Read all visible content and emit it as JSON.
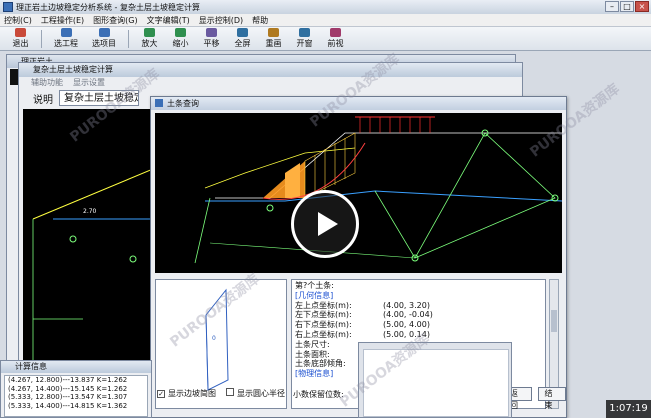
{
  "app": {
    "title": "理正岩土边坡稳定分析系统 - 复杂土层土坡稳定计算",
    "menu": [
      "控制(C)",
      "工程操作(E)",
      "图形查询(G)",
      "文字编辑(T)",
      "显示控制(D)",
      "帮助"
    ],
    "toolbar": [
      {
        "label": "退出",
        "color": "#c94a3a"
      },
      {
        "label": "选工程",
        "color": "#3b6fb6"
      },
      {
        "label": "选项目",
        "color": "#3b6fb6"
      },
      {
        "label": "放大",
        "color": "#2f8f4f"
      },
      {
        "label": "缩小",
        "color": "#2f8f4f"
      },
      {
        "label": "平移",
        "color": "#6a5aa0"
      },
      {
        "label": "全屏",
        "color": "#2f6fa0"
      },
      {
        "label": "重画",
        "color": "#b07a20"
      },
      {
        "label": "开窗",
        "color": "#2f6fa0"
      },
      {
        "label": "前视",
        "color": "#a03a6a"
      }
    ]
  },
  "win1": {
    "title": "理正岩土",
    "strip_text": "05"
  },
  "win2": {
    "title": "复杂土层土坡稳定计算",
    "menu": [
      "辅助功能",
      "显示设置"
    ],
    "tabs": [
      "说明",
      "复杂土层土坡稳定计算"
    ]
  },
  "win3": {
    "title": "土条查询",
    "info_rows": [
      {
        "k": "第?个土条:",
        "v": "",
        "hdr": false
      },
      {
        "k": "[几何信息]",
        "v": "",
        "hdr": true
      },
      {
        "k": "左上点坐标(m):",
        "v": "(4.00, 3.20)",
        "hdr": false
      },
      {
        "k": "左下点坐标(m):",
        "v": "(4.00, -0.04)",
        "hdr": false
      },
      {
        "k": "右下点坐标(m):",
        "v": "(5.00, 4.00)",
        "hdr": false
      },
      {
        "k": "右上点坐标(m):",
        "v": "(5.00, 0.14)",
        "hdr": false
      },
      {
        "k": "土条尺寸:",
        "v": "",
        "hdr": false
      },
      {
        "k": "土条面积:",
        "v": "",
        "hdr": false
      },
      {
        "k": "土条底部倾角:",
        "v": "",
        "hdr": false
      },
      {
        "k": "[物理信息]",
        "v": "",
        "hdr": true
      }
    ],
    "chk_show_edge": "显示边坡简图",
    "chk_show_radius": "显示圆心半径",
    "digits_label": "小数保留位数:",
    "btn_return": "返回",
    "btn_end": "结束"
  },
  "calc": {
    "title": "计算信息",
    "lines": [
      "(4.267, 12.800)---13.837  K=1.262",
      "(4.267, 14.400)---15.145  K=1.262",
      "(5.333, 12.800)---13.547  K=1.307",
      "(5.333, 14.400)---14.815  K=1.362"
    ]
  },
  "watermarks": [
    "PUROOA资源库",
    "PUROOA资源库",
    "PUROOA资源库",
    "PUROOA资源库",
    "PUROOA资源库"
  ],
  "video": {
    "time": "1:07:19"
  }
}
